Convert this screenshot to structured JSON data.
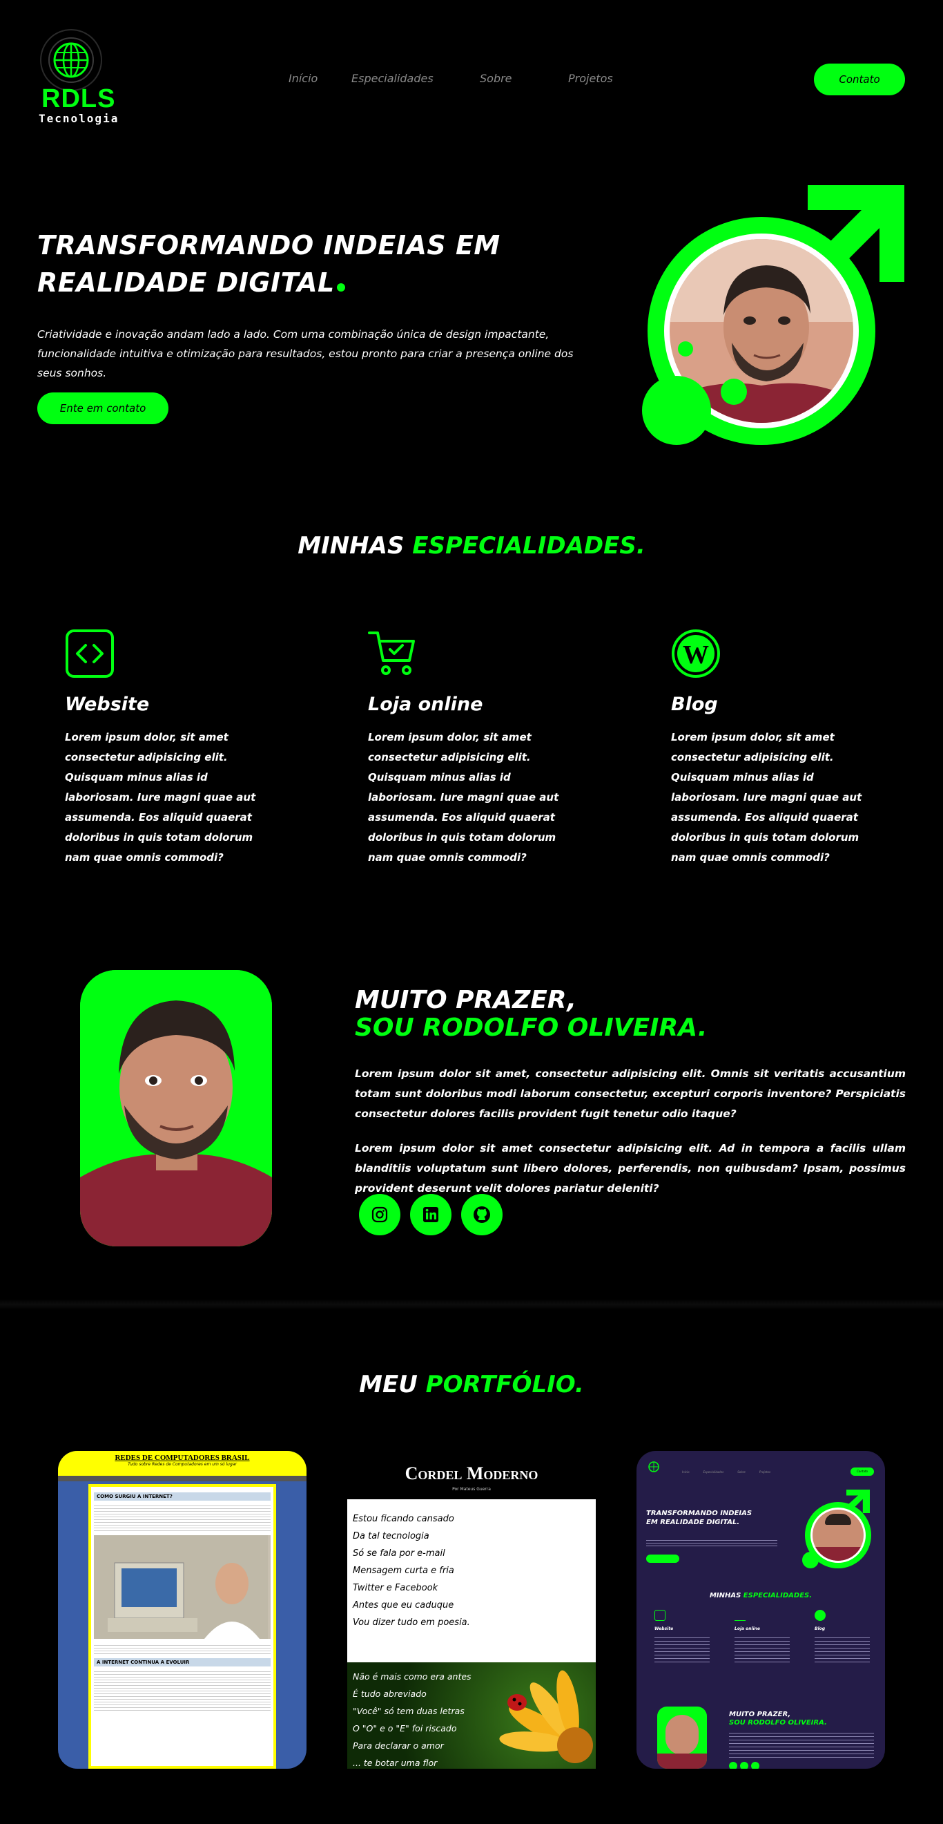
{
  "header": {
    "logo_title": "RDLS",
    "logo_subtitle": "Tecnologia",
    "nav": [
      "Início",
      "Especialidades",
      "Sobre",
      "Projetos"
    ],
    "contact_label": "Contato"
  },
  "hero": {
    "title_line1": "TRANSFORMANDO INDEIAS EM",
    "title_line2": "REALIDADE DIGITAL",
    "text": "Criatividade e inovação andam lado a lado. Com uma combinação única de design impactante, funcionalidade intuitiva e otimização para resultados, estou pronto para criar a presença online dos seus sonhos.",
    "cta_label": "Ente em contato"
  },
  "specialties": {
    "title_white": "MINHAS",
    "title_green": "ESPECIALIDADES.",
    "items": [
      {
        "name": "Website",
        "icon": "code-icon",
        "desc": "Lorem ipsum dolor, sit amet consectetur adipisicing elit. Quisquam minus alias id laboriosam. Iure magni quae aut assumenda. Eos aliquid quaerat doloribus in quis totam dolorum nam quae omnis commodi?"
      },
      {
        "name": "Loja online",
        "icon": "cart-icon",
        "desc": "Lorem ipsum dolor, sit amet consectetur adipisicing elit. Quisquam minus alias id laboriosam. Iure magni quae aut assumenda. Eos aliquid quaerat doloribus in quis totam dolorum nam quae omnis commodi?"
      },
      {
        "name": "Blog",
        "icon": "wordpress-icon",
        "desc": "Lorem ipsum dolor, sit amet consectetur adipisicing elit. Quisquam minus alias id laboriosam. Iure magni quae aut assumenda. Eos aliquid quaerat doloribus in quis totam dolorum nam quae omnis commodi?"
      }
    ]
  },
  "about": {
    "title_line1": "MUITO PRAZER,",
    "title_line2": "SOU RODOLFO OLIVEIRA.",
    "p1": "Lorem ipsum dolor sit amet, consectetur adipisicing elit. Omnis sit veritatis accusantium totam sunt doloribus modi laborum consectetur, excepturi corporis inventore? Perspiciatis consectetur dolores facilis provident fugit tenetur odio itaque?",
    "p2": "Lorem ipsum dolor sit amet consectetur adipisicing elit. Ad in tempora a facilis ullam blanditiis voluptatum sunt libero dolores, perferendis, non quibusdam? Ipsam, possimus provident deserunt velit dolores pariatur deleniti?",
    "social": [
      "instagram-icon",
      "linkedin-icon",
      "github-icon"
    ]
  },
  "portfolio": {
    "title_white": "MEU",
    "title_green": "PORTFÓLIO.",
    "p1": {
      "title": "REDES DE COMPUTADORES BRASIL",
      "subtitle": "Tudo sobre Redes de Computadores em um só lugar",
      "section1": "COMO SURGIU A INTERNET?",
      "section2": "A INTERNET CONTINUA A EVOLUIR"
    },
    "p2": {
      "title": "Cordel Moderno",
      "byline": "Por Mateus Guerra",
      "verse1": [
        "Estou ficando cansado",
        "Da tal tecnologia",
        "Só se fala por e-mail",
        "Mensagem curta e fria",
        "Twitter e Facebook",
        "Antes que eu caduque",
        "Vou dizer tudo em poesia."
      ],
      "verse2": [
        "Não é mais como era antes",
        "É tudo abreviado",
        "\"Você\" só tem duas letras",
        "O \"O\" e o \"E\" foi riscado",
        "Para declarar o amor",
        "... te botar uma flor"
      ]
    },
    "p3": {
      "nav": [
        "Início",
        "Especialidades",
        "Sobre",
        "Projetos"
      ],
      "contact": "Contato",
      "hero_title": "TRANSFORMANDO INDEIAS EM REALIDADE DIGITAL.",
      "specs_white": "MINHAS",
      "specs_green": "ESPECIALIDADES.",
      "specs": [
        "Website",
        "Loja online",
        "Blog"
      ],
      "about1": "MUITO PRAZER,",
      "about2": "SOU RODOLFO OLIVEIRA."
    }
  },
  "colors": {
    "accent": "#00ff11",
    "background": "#000000",
    "card_purple": "#241c48",
    "card_blue": "#3a5ea8"
  }
}
